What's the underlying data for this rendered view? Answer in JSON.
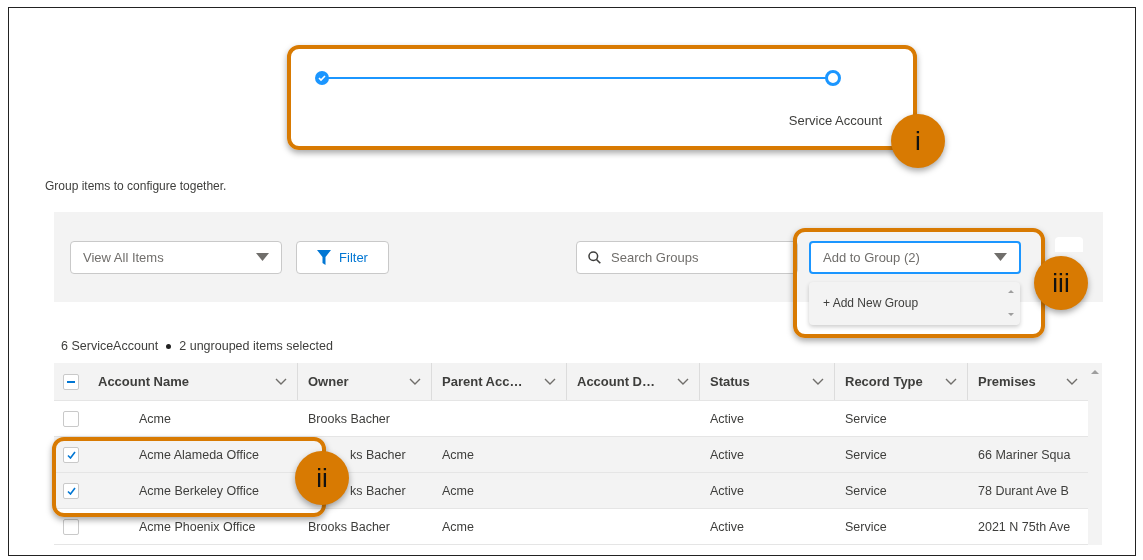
{
  "stepper": {
    "steps": [
      {
        "kind": "complete"
      },
      {
        "kind": "current",
        "label": "Service Account"
      }
    ]
  },
  "intro": "Group items to configure together.",
  "toolbar": {
    "view_select": {
      "value": "View All Items"
    },
    "filter_button": {
      "label": "Filter"
    },
    "search": {
      "placeholder": "Search Groups"
    },
    "add_to_group": {
      "value": "Add to Group (2)",
      "expanded": true,
      "options": [
        "+ Add New Group"
      ]
    }
  },
  "summary": {
    "count": "6 ServiceAccount",
    "selection": "2 ungrouped items selected"
  },
  "table": {
    "header_checkbox": {
      "indeterminate": true
    },
    "columns": [
      "Account Name",
      "Owner",
      "Parent Acc…",
      "Account D…",
      "Status",
      "Record Type",
      "Premises"
    ],
    "rows": [
      {
        "checked": false,
        "cells": [
          "Acme",
          "Brooks Bacher",
          null,
          null,
          "Active",
          "Service",
          null
        ]
      },
      {
        "checked": true,
        "cells": [
          "Acme Alameda Office",
          "ks Bacher",
          "Acme",
          null,
          "Active",
          "Service",
          "66 Mariner Squa"
        ]
      },
      {
        "checked": true,
        "cells": [
          "Acme Berkeley Office",
          "ks Bacher",
          "Acme",
          null,
          "Active",
          "Service",
          "78 Durant Ave B"
        ]
      },
      {
        "checked": false,
        "cells": [
          "Acme Phoenix Office",
          "Brooks Bacher",
          "Acme",
          null,
          "Active",
          "Service",
          "2021 N 75th Ave"
        ]
      }
    ]
  },
  "callouts": [
    {
      "label": "i"
    },
    {
      "label": "iii"
    },
    {
      "label": "ii"
    }
  ]
}
